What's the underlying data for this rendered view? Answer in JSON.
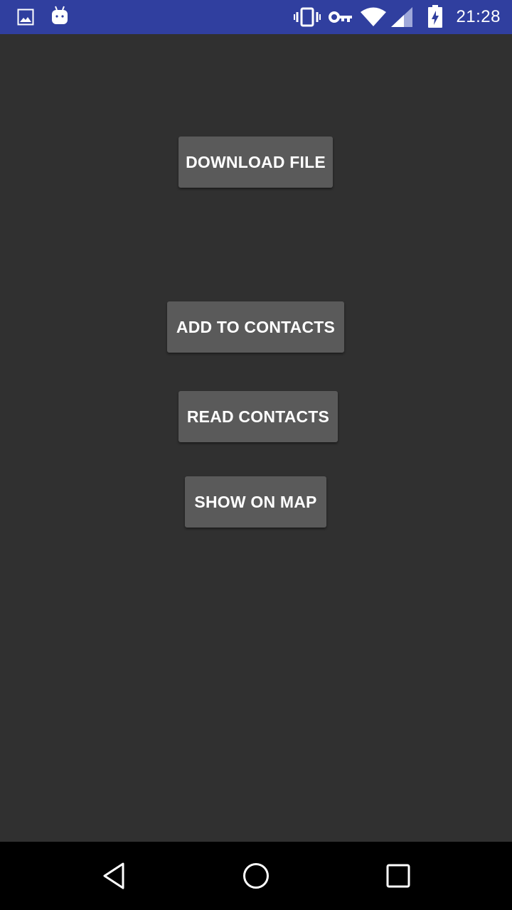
{
  "status_bar": {
    "time": "21:28",
    "background_color": "#303F9F",
    "icons": [
      "image-notification-icon",
      "android-notification-icon",
      "vibrate-icon",
      "vpn-key-icon",
      "wifi-icon",
      "cell-signal-icon",
      "battery-charging-icon"
    ]
  },
  "main": {
    "background_color": "#303030",
    "buttons": {
      "download_file": "DOWNLOAD FILE",
      "add_to_contacts": "ADD TO CONTACTS",
      "read_contacts": "READ CONTACTS",
      "show_on_map": "SHOW ON MAP"
    },
    "button_color": "#5a5a5a"
  },
  "nav_bar": {
    "icons": [
      "back-icon",
      "home-icon",
      "recent-apps-icon"
    ]
  }
}
